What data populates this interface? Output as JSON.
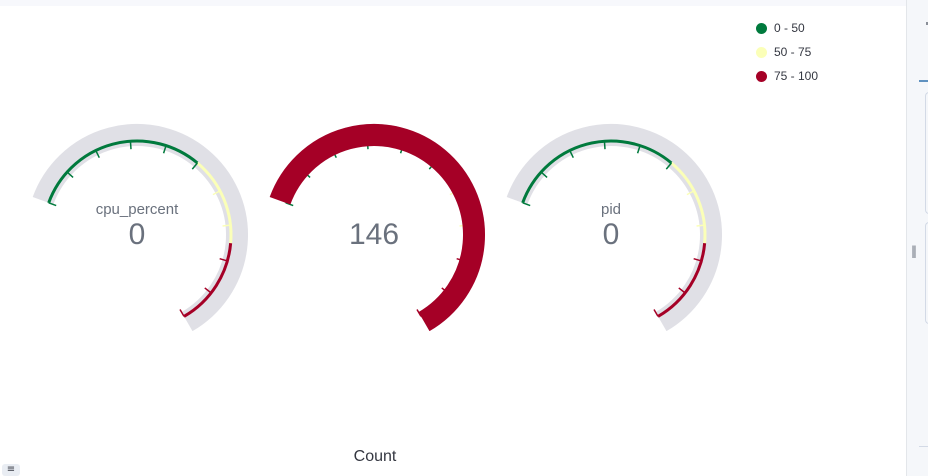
{
  "legend": [
    {
      "label": "0 - 50",
      "color": "#007A3D"
    },
    {
      "label": "50 - 75",
      "color": "#FBFFB8"
    },
    {
      "label": "75 - 100",
      "color": "#A50026"
    }
  ],
  "gauges": [
    {
      "label": "cpu_percent",
      "value_text": "0",
      "value": 0
    },
    {
      "label": "",
      "value_text": "146",
      "value": 146
    },
    {
      "label": "pid",
      "value_text": "0",
      "value": 0
    }
  ],
  "axis_label": "Count",
  "colors": {
    "track": "#E0E0E6",
    "low": "#007A3D",
    "mid": "#FBFFB8",
    "high": "#A50026",
    "value_text": "#6A717D"
  },
  "chart_data": {
    "type": "gauge",
    "range": [
      0,
      100
    ],
    "bands": [
      {
        "from": 0,
        "to": 50,
        "label": "0 - 50",
        "color": "#007A3D"
      },
      {
        "from": 50,
        "to": 75,
        "label": "50 - 75",
        "color": "#FBFFB8"
      },
      {
        "from": 75,
        "to": 100,
        "label": "75 - 100",
        "color": "#A50026"
      }
    ],
    "series": [
      {
        "name": "cpu_percent",
        "value": 0
      },
      {
        "name": "",
        "value": 146
      },
      {
        "name": "pid",
        "value": 0
      }
    ],
    "xlabel": "Count",
    "legend_position": "top-right"
  }
}
